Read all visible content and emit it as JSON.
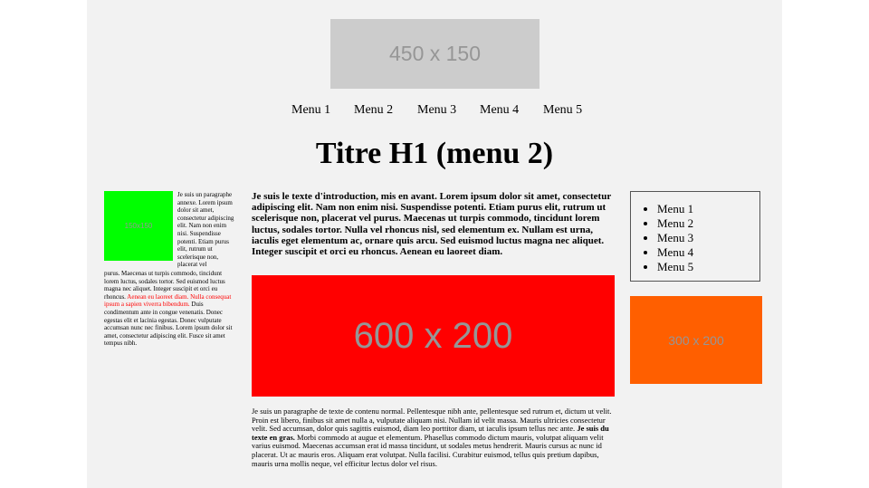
{
  "header": {
    "logo_placeholder": "450 x 150"
  },
  "nav": {
    "items": [
      "Menu 1",
      "Menu 2",
      "Menu 3",
      "Menu 4",
      "Menu 5"
    ]
  },
  "page_title": "Titre H1 (menu 2)",
  "left": {
    "image_placeholder": "150x150",
    "annex_text_right": "Je suis un paragraphe annexe. Lorem ipsum dolor sit amet, consectetur adipiscing elit. Nam non enim nisi. Suspendisse potenti. Etiam purus elit, rutrum ut scelerisque non, placerat vel",
    "annex_text_bottom": "purus. Maecenas ut turpis commodo, tincidunt lorem luctus, sodales tortor. Sed euismod luctus magna nec aliquet. Integer suscipit et orci eu rhoncus.",
    "annex_text_red": "Aenean eu laoreet diam. Nulla consequat ipsum a sapien viverra bibendum.",
    "annex_text_end": "Duis condimentum ante in congue venenatis. Donec egestas elit et lacinia egestas. Donec vulputate accumsan nunc nec finibus. Lorem ipsum dolor sit amet, consectetur adipiscing elit. Fusce sit amet tempus nibh."
  },
  "main": {
    "intro": "Je suis le texte d'introduction, mis en avant. Lorem ipsum dolor sit amet, consectetur adipiscing elit. Nam non enim nisi. Suspendisse potenti. Etiam purus elit, rutrum ut scelerisque non, placerat vel purus. Maecenas ut turpis commodo, tincidunt lorem luctus, sodales tortor. Nulla vel rhoncus nisl, sed elementum ex. Nullam est urna, iaculis eget elementum ac, ornare quis arcu. Sed euismod luctus magna nec aliquet. Integer suscipit et orci eu rhoncus. Aenean eu laoreet diam.",
    "banner_placeholder": "600 x 200",
    "body_text_1": "Je suis un paragraphe de texte de contenu normal. Pellentesque nibh ante, pellentesque sed rutrum et, dictum ut velit. Proin est libero, finibus sit amet nulla a, vulputate aliquam nisi. Nullam id velit massa. Mauris ultricies consectetur velit. Sed accumsan, dolor quis sagittis euismod, diam leo porttitor diam, ut iaculis ipsum tellus nec ante. ",
    "body_text_bold": "Je suis du texte en gras.",
    "body_text_2": " Morbi commodo at augue et elementum. Phasellus commodo dictum mauris, volutpat aliquam velit varius euismod. Maecenas accumsan erat id massa tincidunt, ut sodales metus hendrerit. Mauris cursus ac nunc id placerat. Ut ac mauris eros. Aliquam erat volutpat. Nulla facilisi. Curabitur euismod, tellus quis pretium dapibus, mauris urna mollis neque, vel efficitur lectus dolor vel risus."
  },
  "right": {
    "menu_items": [
      "Menu 1",
      "Menu 2",
      "Menu 3",
      "Menu 4",
      "Menu 5"
    ],
    "ad_placeholder": "300 x 200"
  },
  "colors": {
    "page_bg": "#f2f2f2",
    "logo_bg": "#cccccc",
    "green_box": "#00ff00",
    "red_banner": "#ff0000",
    "orange_box": "#ff5f00",
    "highlight_text": "#ff0000"
  }
}
